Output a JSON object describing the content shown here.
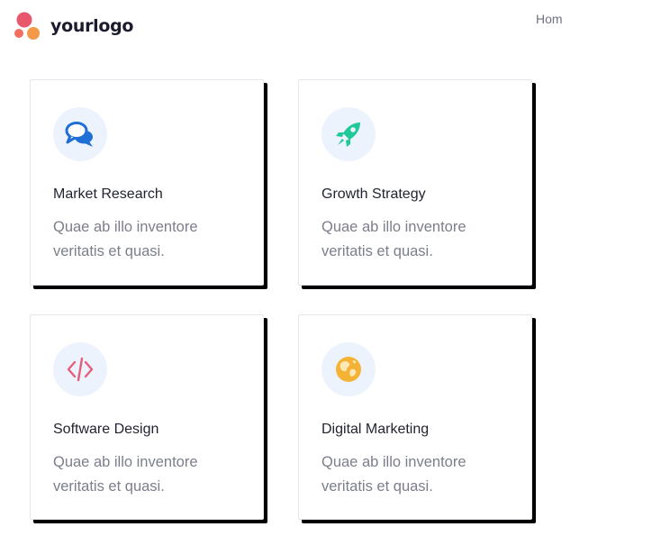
{
  "header": {
    "logo_text": "yourlogo",
    "nav": {
      "home_label": "Home"
    }
  },
  "colors": {
    "logo_primary": "#e8576b",
    "logo_secondary": "#f2994a",
    "chat_icon": "#1f6fd6",
    "rocket_icon": "#20c997",
    "code_icon": "#e45f7a",
    "globe_icon": "#f5b335",
    "icon_background": "#edf3fd",
    "card_shadow": "#000000"
  },
  "cards": [
    {
      "icon": "chat-bubbles-icon",
      "title": "Market Research",
      "description": "Quae ab illo inventore veritatis et quasi."
    },
    {
      "icon": "rocket-icon",
      "title": "Growth Strategy",
      "description": "Quae ab illo inventore veritatis et quasi."
    },
    {
      "icon": "code-icon",
      "title": "Software Design",
      "description": "Quae ab illo inventore veritatis et quasi."
    },
    {
      "icon": "globe-icon",
      "title": "Digital Marketing",
      "description": "Quae ab illo inventore veritatis et quasi."
    }
  ]
}
